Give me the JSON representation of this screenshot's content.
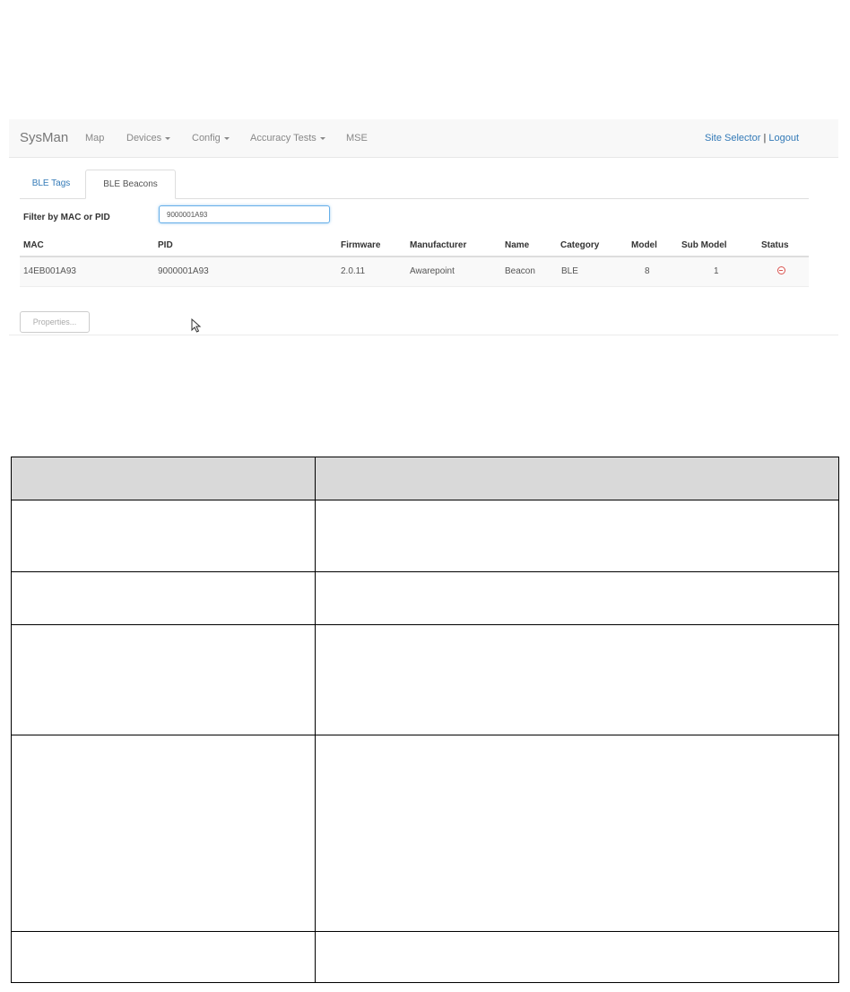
{
  "navbar": {
    "brand": "SysMan",
    "items": [
      "Map",
      "Devices",
      "Config",
      "Accuracy Tests",
      "MSE"
    ],
    "site_selector": "Site Selector",
    "separator": "|",
    "logout": "Logout"
  },
  "tabs": [
    {
      "label": "BLE Tags",
      "active": false
    },
    {
      "label": "BLE Beacons",
      "active": true
    }
  ],
  "filter": {
    "label": "Filter by MAC or PID",
    "value": "9000001A93"
  },
  "table": {
    "columns": [
      "MAC",
      "PID",
      "Firmware",
      "Manufacturer",
      "Name",
      "Category",
      "Model",
      "Sub Model",
      "Status"
    ],
    "rows": [
      {
        "mac": "14EB001A93",
        "pid": "9000001A93",
        "firmware": "2.0.11",
        "manufacturer": "Awarepoint",
        "name": "Beacon",
        "category": "BLE",
        "model": "8",
        "sub_model": "1",
        "status_icon": "error-circle-icon"
      }
    ]
  },
  "properties_button": "Properties...",
  "colors": {
    "link": "#337ab7",
    "navbar_bg": "#f8f8f8",
    "status_error": "#d9534f",
    "doc_header_bg": "#d9d9d9"
  }
}
